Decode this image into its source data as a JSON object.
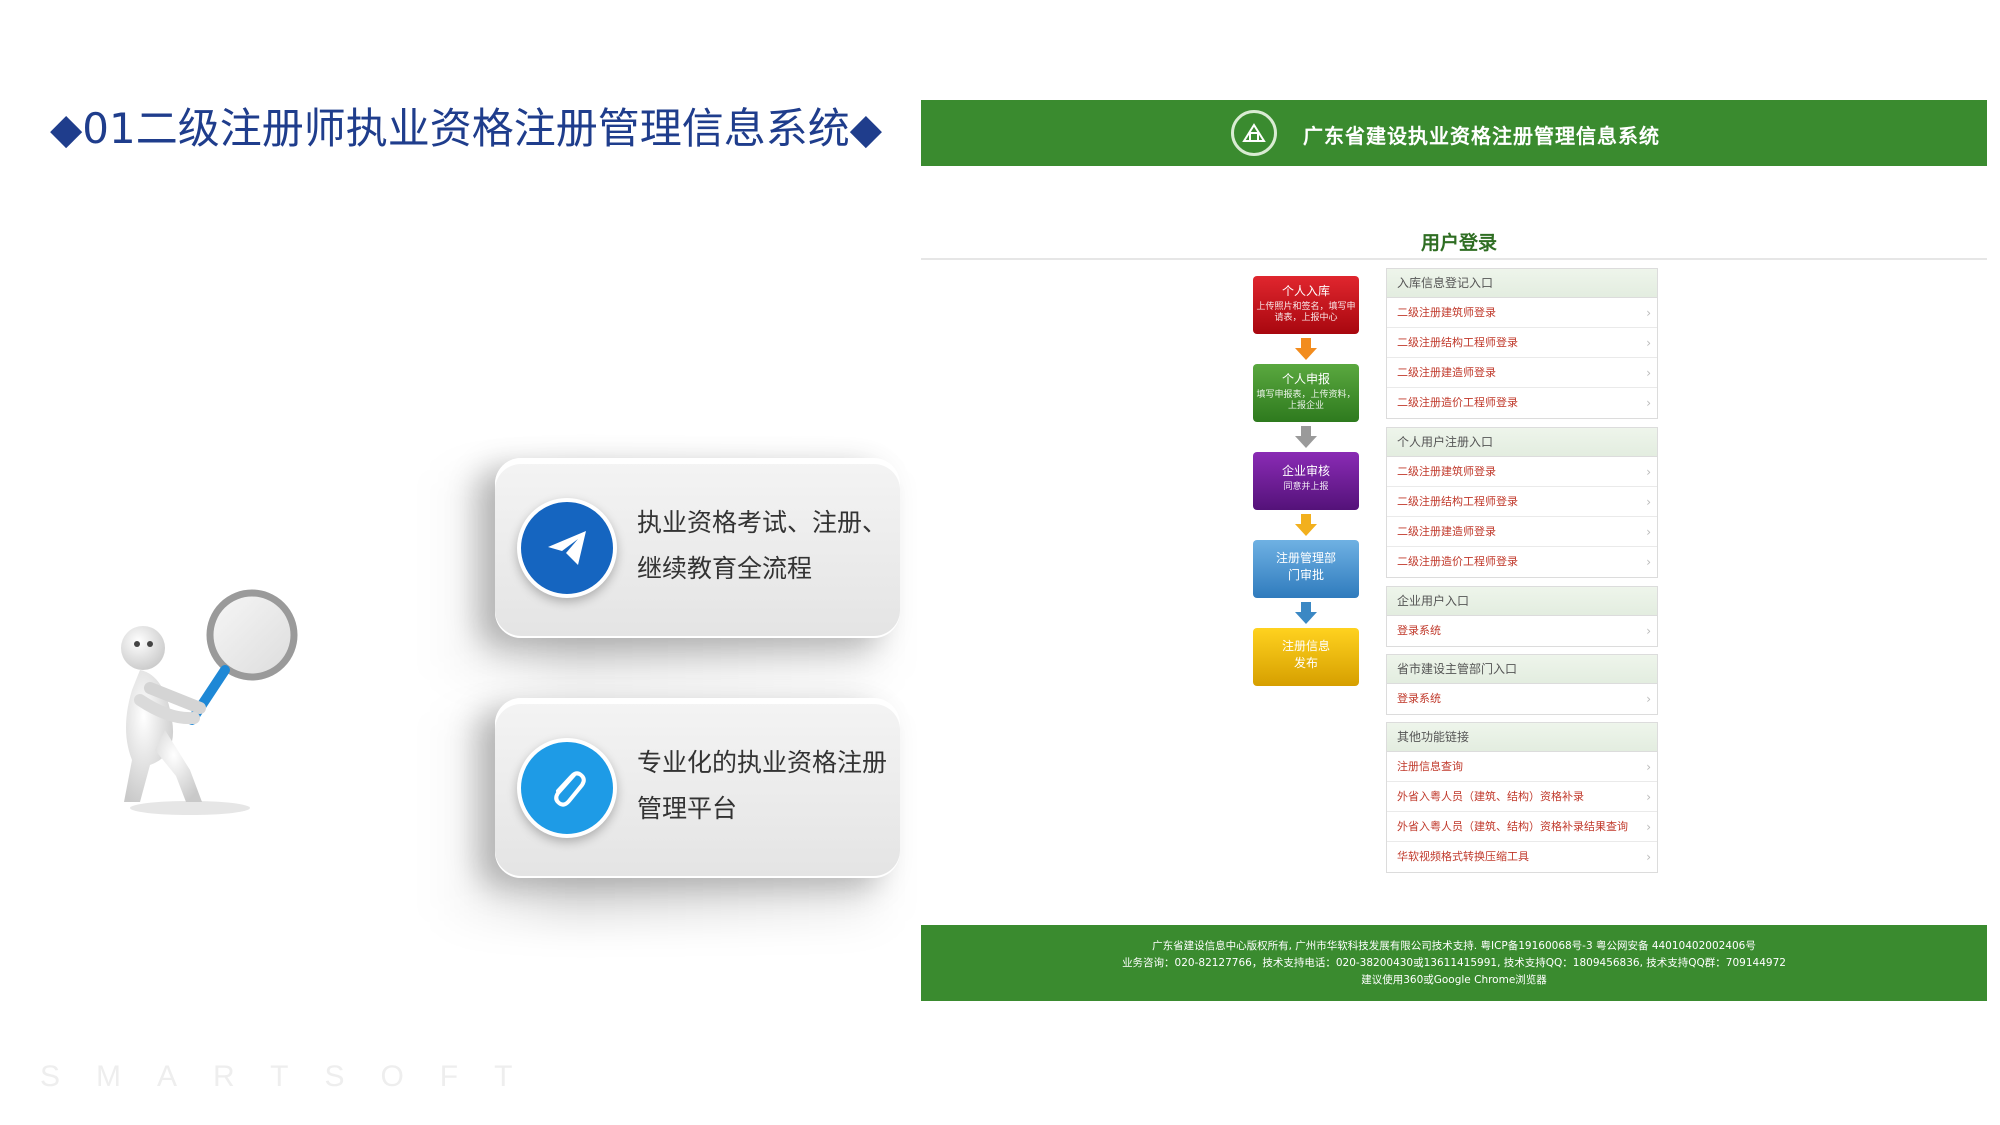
{
  "slide": {
    "title": "◆01二级注册师执业资格注册管理信息系统◆",
    "watermark": "SMARTSOFT"
  },
  "cards": [
    {
      "icon": "paper-plane-icon",
      "color": "#1565c0",
      "text": "执业资格考试、注册、继续教育全流程"
    },
    {
      "icon": "paperclip-icon",
      "color": "#1e9be6",
      "text": "专业化的执业资格注册管理平台"
    }
  ],
  "screenshot": {
    "header_title": "广东省建设执业资格注册管理信息系统",
    "login_title": "用户登录",
    "flow": [
      {
        "title": "个人入库",
        "sub": "上传照片和签名，填写申请表，上报中心",
        "color": "#c0101a"
      },
      {
        "title": "个人申报",
        "sub": "填写申报表，上传资料，上报企业",
        "color": "#3e8e2c"
      },
      {
        "title": "企业审核",
        "sub": "同意并上报",
        "color": "#6a1b9a"
      },
      {
        "title": "注册管理部门审批",
        "sub": "",
        "color": "#3b88c4"
      },
      {
        "title": "注册信息发布",
        "sub": "",
        "color": "#e3b400"
      }
    ],
    "menu_groups": [
      {
        "head": "入库信息登记入口",
        "items": [
          "二级注册建筑师登录",
          "二级注册结构工程师登录",
          "二级注册建造师登录",
          "二级注册造价工程师登录"
        ]
      },
      {
        "head": "个人用户注册入口",
        "items": [
          "二级注册建筑师登录",
          "二级注册结构工程师登录",
          "二级注册建造师登录",
          "二级注册造价工程师登录"
        ]
      },
      {
        "head": "企业用户入口",
        "items": [
          "登录系统"
        ]
      },
      {
        "head": "省市建设主管部门入口",
        "items": [
          "登录系统"
        ]
      },
      {
        "head": "其他功能链接",
        "items": [
          "注册信息查询",
          "外省入粤人员（建筑、结构）资格补录",
          "外省入粤人员（建筑、结构）资格补录结果查询",
          "华软视频格式转换压缩工具"
        ]
      }
    ],
    "footer": {
      "line1": "广东省建设信息中心版权所有, 广州市华软科技发展有限公司技术支持. 粤ICP备19160068号-3 粤公网安备 44010402002406号",
      "line2": "业务咨询：020-82127766，技术支持电话：020-38200430或13611415991, 技术支持QQ：1809456836, 技术支持QQ群：709144972",
      "line3": "建议使用360或Google Chrome浏览器"
    }
  }
}
